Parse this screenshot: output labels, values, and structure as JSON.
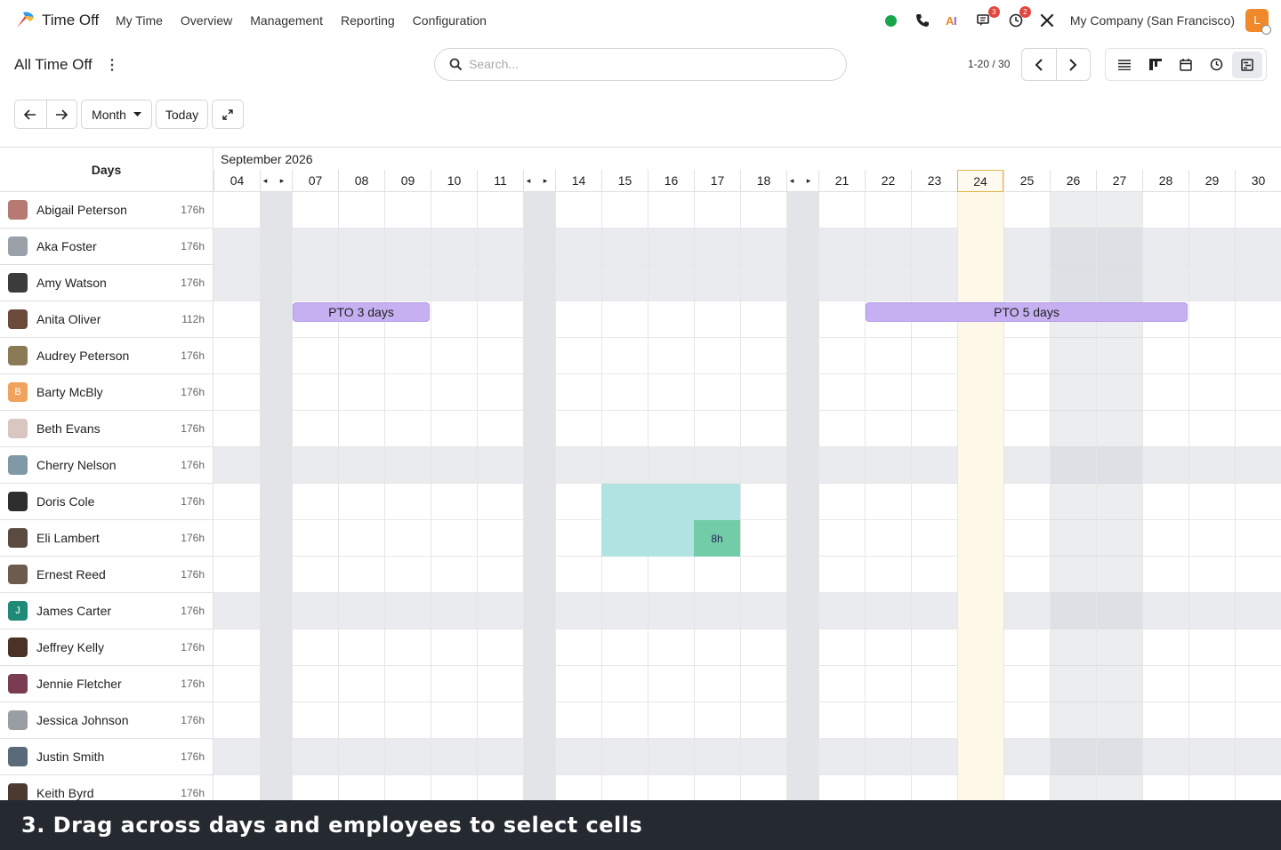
{
  "app": {
    "name": "Time Off",
    "menu": [
      "My Time",
      "Overview",
      "Management",
      "Reporting",
      "Configuration"
    ],
    "company": "My Company (San Francisco)",
    "user_initial": "L",
    "badges": {
      "messages": "3",
      "activities": "2"
    },
    "colors": {
      "status_green": "#17a64a",
      "badge_red": "#e2473f",
      "user_orange": "#f0892c"
    }
  },
  "control_panel": {
    "title": "All Time Off",
    "search_placeholder": "Search...",
    "pager": "1-20 / 30"
  },
  "gantt_controls": {
    "scale": "Month",
    "today": "Today"
  },
  "gantt": {
    "row_header": "Days",
    "month": "September 2026",
    "days": [
      "04",
      "◂ ▸",
      "07",
      "08",
      "09",
      "10",
      "11",
      "◂ ▸",
      "14",
      "15",
      "16",
      "17",
      "18",
      "◂ ▸",
      "21",
      "22",
      "23",
      "24",
      "25",
      "26",
      "27",
      "28",
      "29",
      "30"
    ],
    "today": "24",
    "employees": [
      {
        "name": "Abigail Peterson",
        "hours": "176h",
        "avatar": "#b77a72"
      },
      {
        "name": "Aka Foster",
        "hours": "176h",
        "avatar": "#9aa0a8"
      },
      {
        "name": "Amy Watson",
        "hours": "176h",
        "avatar": "#3b3b3b"
      },
      {
        "name": "Anita Oliver",
        "hours": "112h",
        "avatar": "#6b4a3a"
      },
      {
        "name": "Audrey Peterson",
        "hours": "176h",
        "avatar": "#8a7a56"
      },
      {
        "name": "Barty McBly",
        "hours": "176h",
        "avatar": "#f0a35e",
        "initial": "B"
      },
      {
        "name": "Beth Evans",
        "hours": "176h",
        "avatar": "#d9c6c0"
      },
      {
        "name": "Cherry Nelson",
        "hours": "176h",
        "avatar": "#7f9aa6"
      },
      {
        "name": "Doris Cole",
        "hours": "176h",
        "avatar": "#2e2e2e"
      },
      {
        "name": "Eli Lambert",
        "hours": "176h",
        "avatar": "#5a4a40"
      },
      {
        "name": "Ernest Reed",
        "hours": "176h",
        "avatar": "#6d5b4e"
      },
      {
        "name": "James Carter",
        "hours": "176h",
        "avatar": "#1f8a78",
        "initial": "J"
      },
      {
        "name": "Jeffrey Kelly",
        "hours": "176h",
        "avatar": "#4a3226"
      },
      {
        "name": "Jennie Fletcher",
        "hours": "176h",
        "avatar": "#7a3c52"
      },
      {
        "name": "Jessica Johnson",
        "hours": "176h",
        "avatar": "#9a9ea4"
      },
      {
        "name": "Justin Smith",
        "hours": "176h",
        "avatar": "#5a6a7a"
      },
      {
        "name": "Keith Byrd",
        "hours": "176h",
        "avatar": "#4a3a30"
      }
    ],
    "pills": [
      {
        "label": "PTO 3 days",
        "employee": "Anita Oliver",
        "start": "07",
        "end": "09"
      },
      {
        "label": "PTO 5 days",
        "employee": "Anita Oliver",
        "start": "22",
        "end": "28"
      }
    ],
    "selection_label": "8h"
  },
  "caption": "3. Drag across days and employees to select cells"
}
